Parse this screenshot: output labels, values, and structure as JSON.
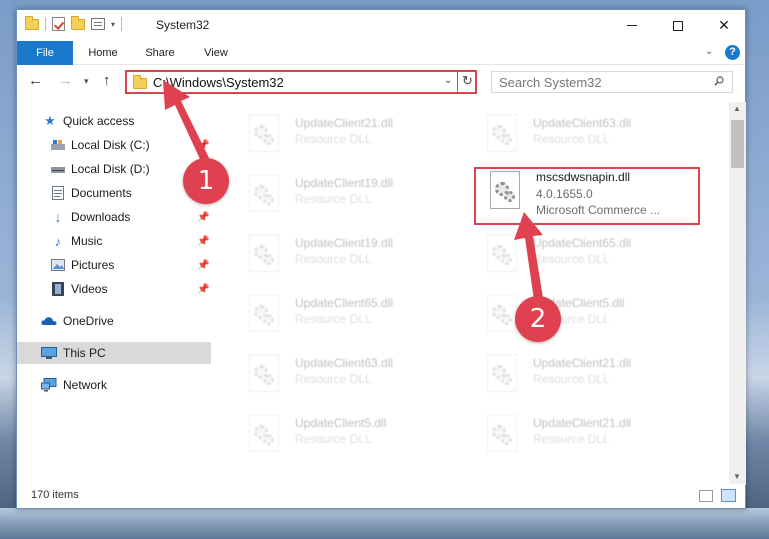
{
  "window": {
    "title": "System32",
    "minimize_label": "",
    "maximize_label": "",
    "close_label": "✕"
  },
  "ribbon": {
    "tabs": [
      "File",
      "Home",
      "Share",
      "View"
    ],
    "help": "?"
  },
  "nav": {
    "address": "C:\\Windows\\System32",
    "search_placeholder": "Search System32"
  },
  "sidebar": {
    "items": [
      {
        "label": "Quick access",
        "icon": "star-icon",
        "pinned": false
      },
      {
        "label": "Local Disk (C:)",
        "icon": "drive-icon",
        "pinned": true
      },
      {
        "label": "Local Disk (D:)",
        "icon": "drive-icon",
        "pinned": false
      },
      {
        "label": "Documents",
        "icon": "documents-icon",
        "pinned": true
      },
      {
        "label": "Downloads",
        "icon": "download-arrow-icon",
        "pinned": true
      },
      {
        "label": "Music",
        "icon": "music-note-icon",
        "pinned": true
      },
      {
        "label": "Pictures",
        "icon": "pictures-icon",
        "pinned": true
      },
      {
        "label": "Videos",
        "icon": "film-icon",
        "pinned": true
      },
      {
        "label": "OneDrive",
        "icon": "cloud-icon",
        "pinned": false
      },
      {
        "label": "This PC",
        "icon": "monitor-icon",
        "pinned": false,
        "selected": true
      },
      {
        "label": "Network",
        "icon": "network-icon",
        "pinned": false
      }
    ]
  },
  "files": {
    "left": [
      {
        "name": "UpdateClient21.dll",
        "desc": "Resource DLL"
      },
      {
        "name": "UpdateClient19.dll",
        "desc": "Resource DLL"
      },
      {
        "name": "UpdateClient19.dll",
        "desc": "Resource DLL"
      },
      {
        "name": "UpdateClient65.dll",
        "desc": "Resource DLL"
      },
      {
        "name": "UpdateClient63.dll",
        "desc": "Resource DLL"
      },
      {
        "name": "UpdateClient5.dll",
        "desc": "Resource DLL"
      }
    ],
    "right": [
      {
        "name": "UpdateClient63.dll",
        "desc": "Resource DLL"
      },
      {
        "name": "UpdateClient65.dll",
        "desc": "Resource DLL"
      },
      {
        "name": "UpdateClient5.dll",
        "desc": "Resource DLL"
      },
      {
        "name": "UpdateClient21.dll",
        "desc": "Resource DLL"
      },
      {
        "name": "UpdateClient21.dll",
        "desc": "Resource DLL"
      }
    ],
    "highlighted": {
      "name": "mscsdwsnapin.dll",
      "version": "4.0.1655.0",
      "company": "Microsoft Commerce ..."
    }
  },
  "status": {
    "item_count": "170 items"
  },
  "annotations": {
    "step1": "1",
    "step2": "2",
    "color": "#df4150"
  }
}
